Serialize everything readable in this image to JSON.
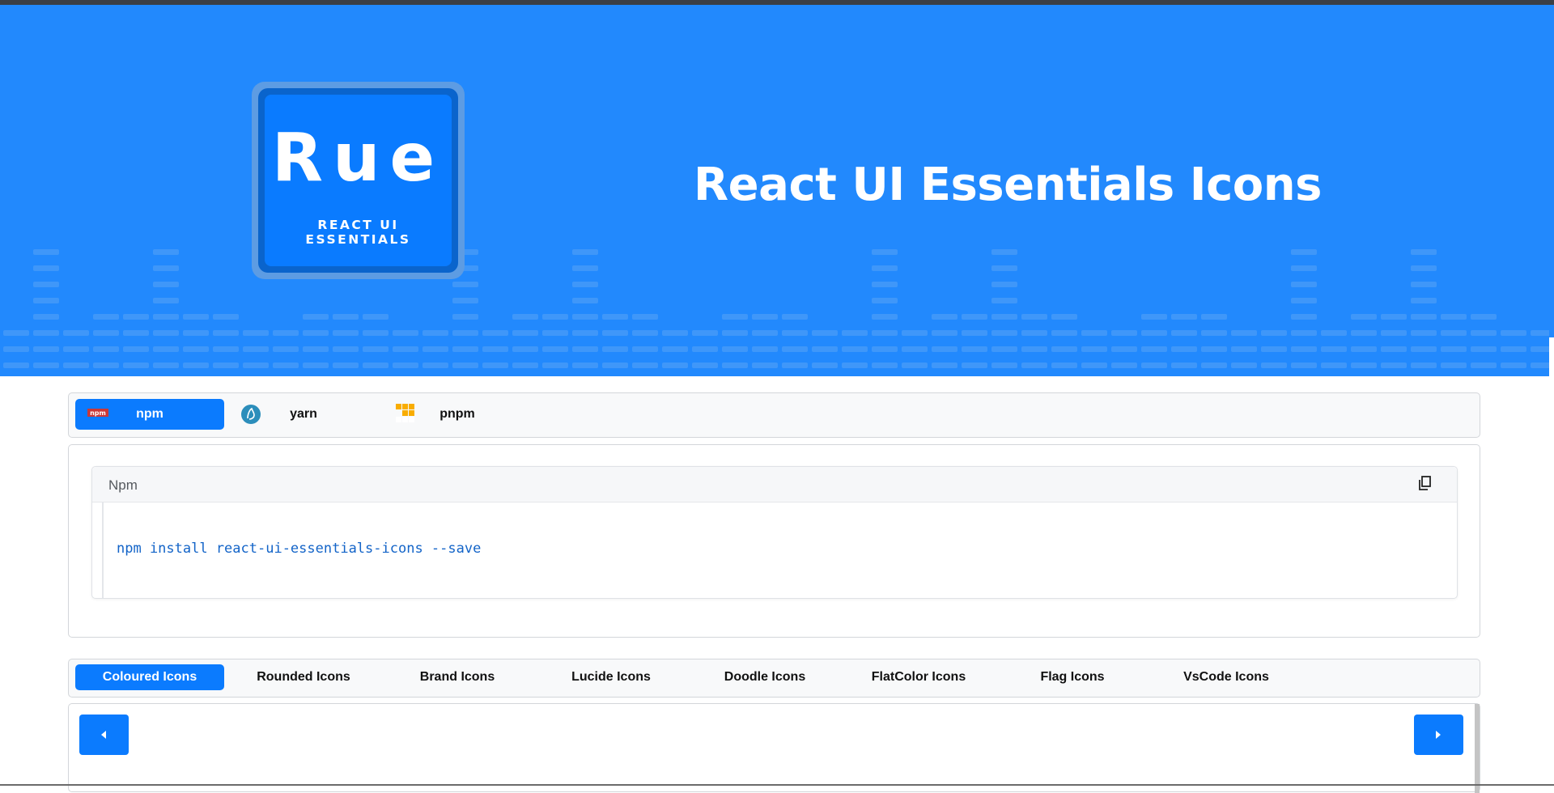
{
  "hero": {
    "logo_letters": "Rue",
    "logo_subtitle": "REACT UI ESSENTIALS",
    "title": "React UI Essentials Icons",
    "background_color": "#2289fd"
  },
  "package_managers": {
    "tabs": [
      {
        "label": "npm",
        "icon": "npm-logo-icon",
        "active": true
      },
      {
        "label": "yarn",
        "icon": "yarn-logo-icon",
        "active": false
      },
      {
        "label": "pnpm",
        "icon": "pnpm-logo-icon",
        "active": false
      }
    ]
  },
  "install": {
    "title": "Npm",
    "command": "npm install react-ui-essentials-icons --save",
    "copy_icon": "copy-icon"
  },
  "icon_sets": {
    "tabs": [
      {
        "label": "Coloured Icons",
        "active": true
      },
      {
        "label": "Rounded Icons",
        "active": false
      },
      {
        "label": "Brand Icons",
        "active": false
      },
      {
        "label": "Lucide Icons",
        "active": false
      },
      {
        "label": "Doodle Icons",
        "active": false
      },
      {
        "label": "FlatColor Icons",
        "active": false
      },
      {
        "label": "Flag Icons",
        "active": false
      },
      {
        "label": "VsCode Icons",
        "active": false
      }
    ]
  },
  "gallery": {
    "prev_icon": "caret-left-icon",
    "next_icon": "caret-right-icon"
  },
  "colors": {
    "accent": "#0b7bfe",
    "code_text": "#1364c8"
  }
}
